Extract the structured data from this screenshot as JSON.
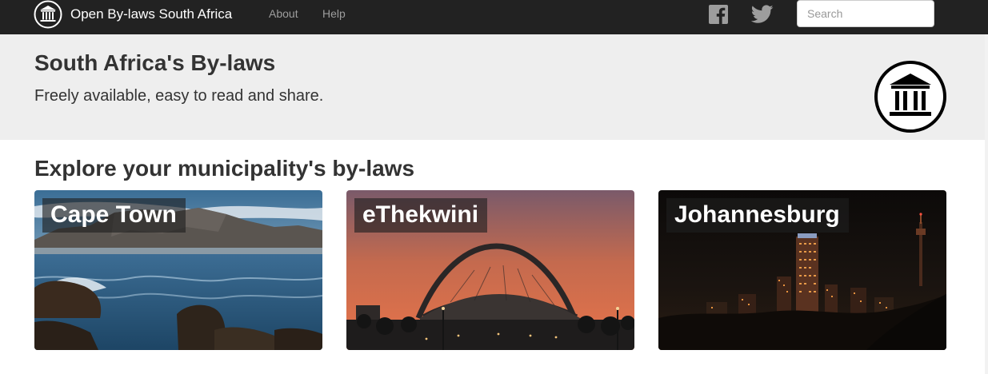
{
  "navbar": {
    "brand": "Open By-laws South Africa",
    "brand_icon": "courthouse-icon",
    "links": [
      "About",
      "Help"
    ],
    "social": [
      "facebook-icon",
      "twitter-icon"
    ],
    "search_placeholder": "Search"
  },
  "hero": {
    "title": "South Africa's By-laws",
    "subtitle": "Freely available, easy to read and share.",
    "logo_icon": "courthouse-icon"
  },
  "section": {
    "title": "Explore your municipality's by-laws"
  },
  "municipalities": [
    "Cape Town",
    "eThekwini",
    "Johannesburg"
  ],
  "colors": {
    "navbar_bg": "#222222",
    "hero_bg": "#eeeeee",
    "nav_link": "#9d9d9d",
    "text": "#333333"
  }
}
